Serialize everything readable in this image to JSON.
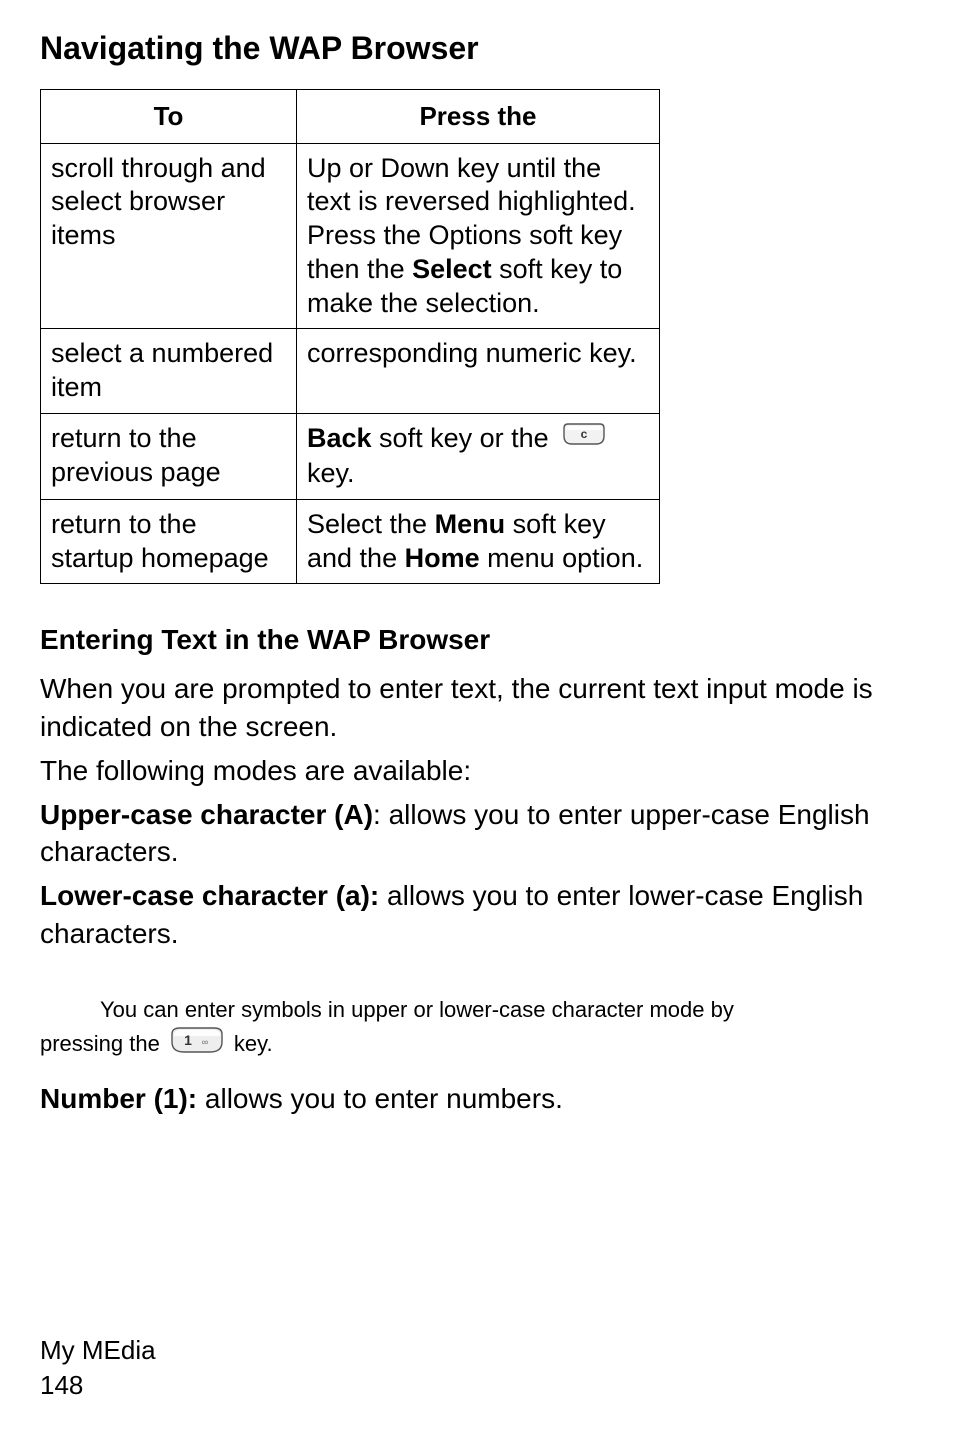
{
  "heading": "Navigating the WAP Browser",
  "table": {
    "headers": {
      "to": "To",
      "press": "Press the"
    },
    "rows": [
      {
        "to": "scroll through and select browser items",
        "press_pre": "Up or Down key until the text is reversed highlighted. Press the Options soft key then the ",
        "press_bold": "Select",
        "press_post": " soft key to make the selection."
      },
      {
        "to": "select a numbered item",
        "press": "corresponding numeric key."
      },
      {
        "to": "return to the previous page",
        "press_bold": "Back",
        "press_mid": " soft key or the ",
        "press_post": "key."
      },
      {
        "to": "return to the startup homepage",
        "press_pre": "Select the ",
        "press_bold1": "Menu",
        "press_mid": " soft key and the ",
        "press_bold2": "Home",
        "press_post": " menu option."
      }
    ]
  },
  "subheading": "Entering Text in the WAP Browser",
  "para_intro1": "When you are prompted to enter text, the current text input mode is indicated on the screen.",
  "para_intro2": "The following modes are available:",
  "mode_upper_label": "Upper-case character (A)",
  "mode_upper_text": ": allows you to enter upper-case English characters.",
  "mode_lower_label": "Lower-case character (a):",
  "mode_lower_text": " allows you to enter lower-case English characters.",
  "note_line1": "You can enter symbols in upper or lower-case character mode by",
  "note_line2_pre": "pressing the ",
  "note_line2_post": " key.",
  "mode_number_label": "Number (1):",
  "mode_number_text": " allows you to enter numbers.",
  "footer_text": "My MEdia",
  "footer_page": "148",
  "icons": {
    "c_key": "c-key-icon",
    "one_key": "one-key-icon"
  }
}
